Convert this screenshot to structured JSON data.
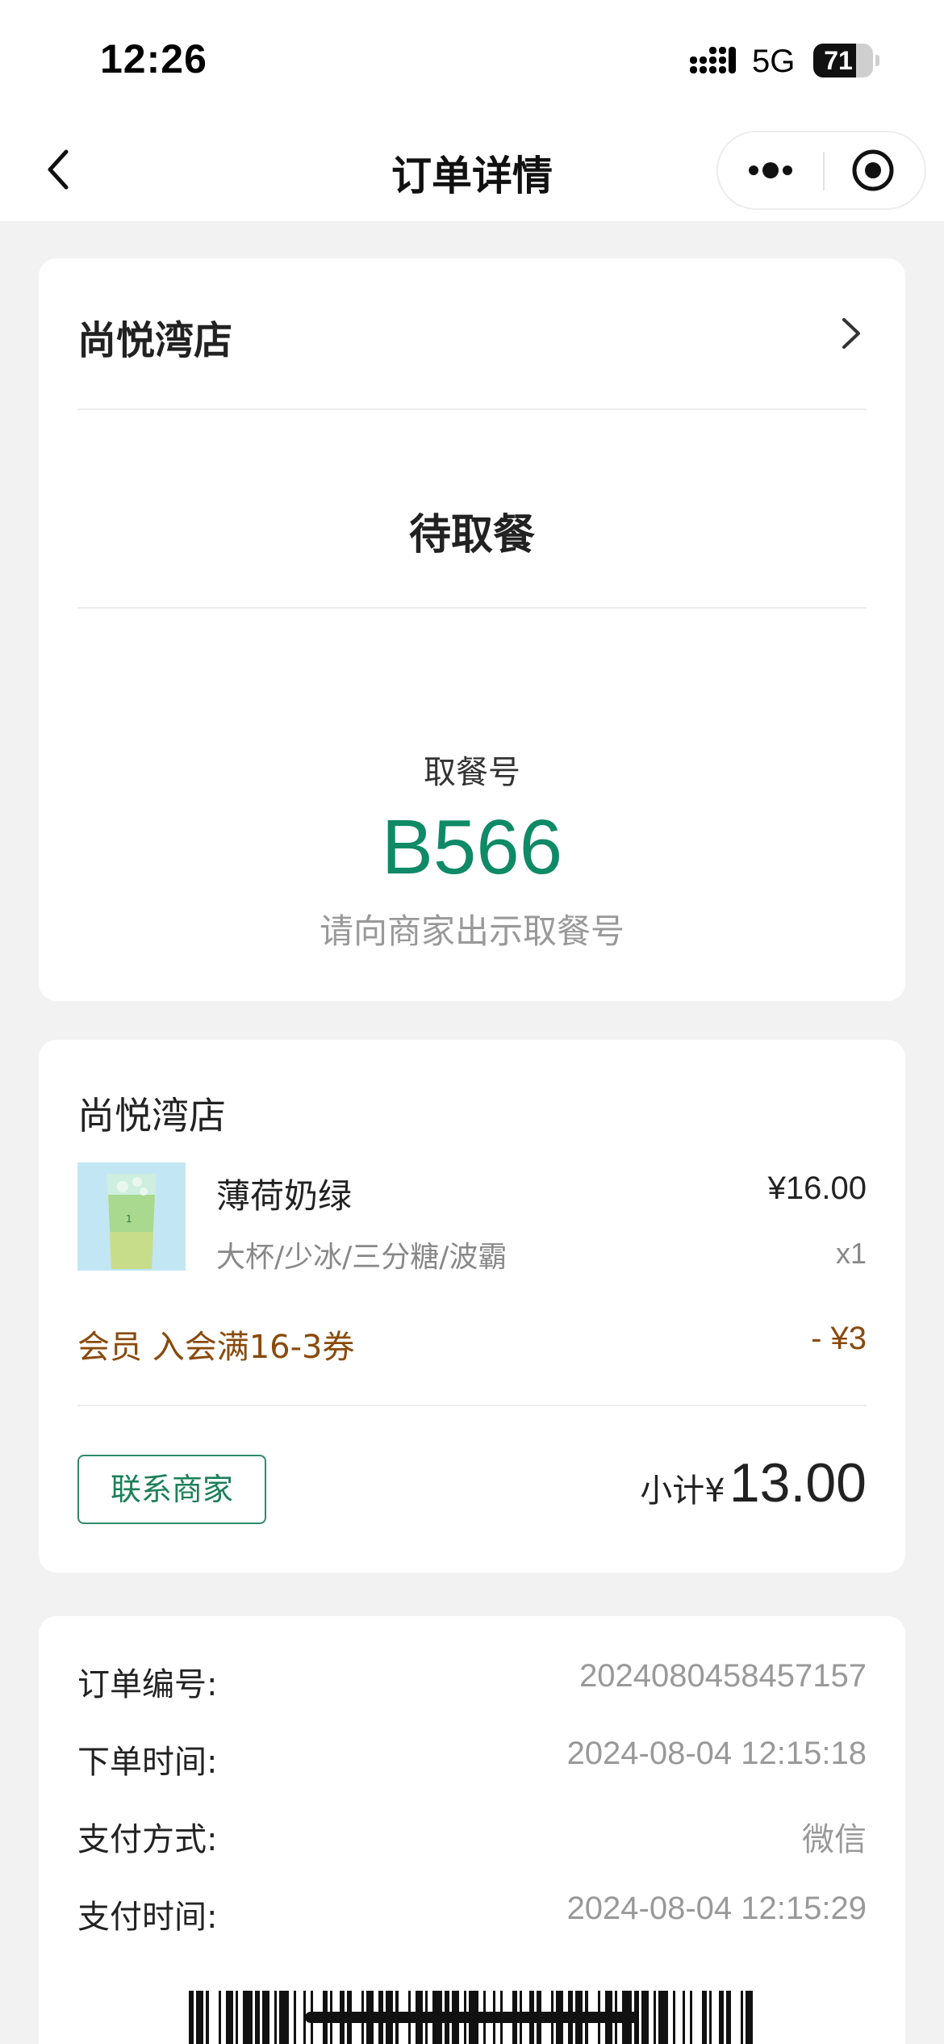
{
  "status_bar": {
    "time": "12:26",
    "network": "5G",
    "battery": "71",
    "battery_level_percent": 71
  },
  "nav": {
    "title": "订单详情",
    "back_icon": "chevron-left-icon",
    "more_icon": "more-dots-icon",
    "close_icon": "target-circle-icon"
  },
  "pickup_card": {
    "store_name": "尚悦湾店",
    "status": "待取餐",
    "pickup_label": "取餐号",
    "pickup_code": "B566",
    "pickup_hint": "请向商家出示取餐号"
  },
  "order_card": {
    "store_name": "尚悦湾店",
    "items": [
      {
        "name": "薄荷奶绿",
        "spec": "大杯/少冰/三分糖/波霸",
        "price": "¥16.00",
        "qty": "x1"
      }
    ],
    "discount": {
      "label": "会员 入会满16-3券",
      "amount": "- ¥3"
    },
    "contact_button": "联系商家",
    "subtotal_label": "小计¥",
    "subtotal_amount": "13.00"
  },
  "info_card": {
    "rows": [
      {
        "label": "订单编号:",
        "value": "2024080458457157"
      },
      {
        "label": "下单时间:",
        "value": "2024-08-04 12:15:18"
      },
      {
        "label": "支付方式:",
        "value": "微信"
      },
      {
        "label": "支付时间:",
        "value": "2024-08-04 12:15:29"
      }
    ]
  },
  "colors": {
    "accent_green": "#0e8a66",
    "discount_brown": "#8a4a0c",
    "background": "#f2f2f2"
  }
}
